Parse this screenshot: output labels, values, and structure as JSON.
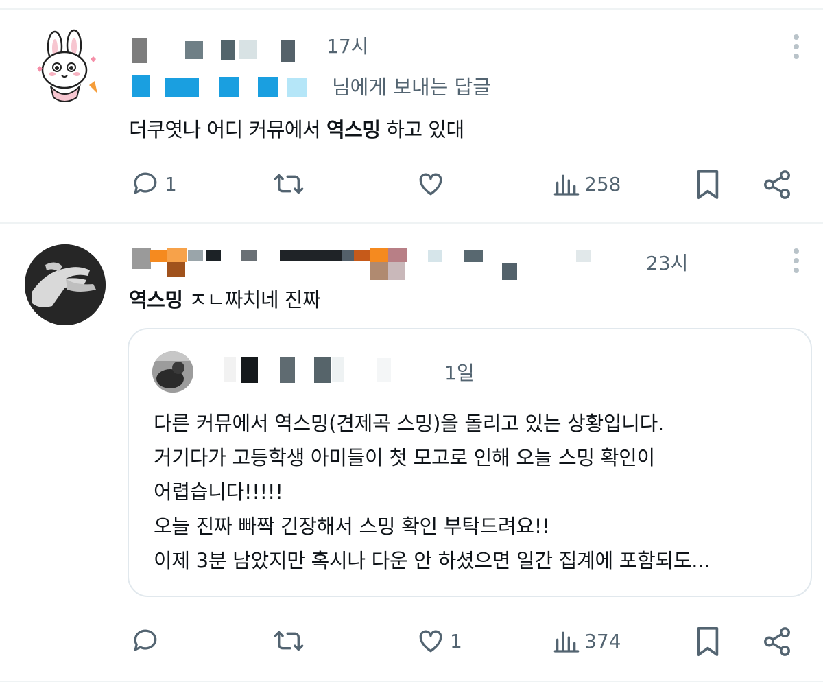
{
  "tweets": [
    {
      "time": "17시",
      "reply_to_suffix": "님에게 보내는 답글",
      "text_pre": "더쿠엿나 어디 커뮤에서 ",
      "text_bold": "역스밍",
      "text_post": " 하고 있대",
      "actions": {
        "replies": "1",
        "retweets": "",
        "likes": "",
        "views": "258"
      }
    },
    {
      "time": "23시",
      "text_bold": "역스밍",
      "text_post": " ㅈㄴ짜치네 진짜",
      "quote": {
        "time": "1일",
        "lines": [
          "다른 커뮤에서 역스밍(견제곡 스밍)을 돌리고 있는 상황입니다.",
          "거기다가 고등학생 아미들이 첫 모고로 인해 오늘 스밍 확인이",
          "어렵습니다!!!!!",
          "오늘 진짜 빠짝 긴장해서 스밍 확인 부탁드려요!!",
          "이제 3분 남았지만 혹시나 다운 안 하셨으면 일간 집계에 포함되도..."
        ]
      },
      "actions": {
        "replies": "",
        "retweets": "",
        "likes": "1",
        "views": "374"
      }
    }
  ],
  "icons": [
    "reply-icon",
    "retweet-icon",
    "like-icon",
    "views-icon",
    "bookmark-icon",
    "share-icon",
    "more-icon"
  ],
  "colors": {
    "text": "#0f1419",
    "secondary": "#536471",
    "divider": "#eff3f4",
    "icon": "#536471"
  }
}
